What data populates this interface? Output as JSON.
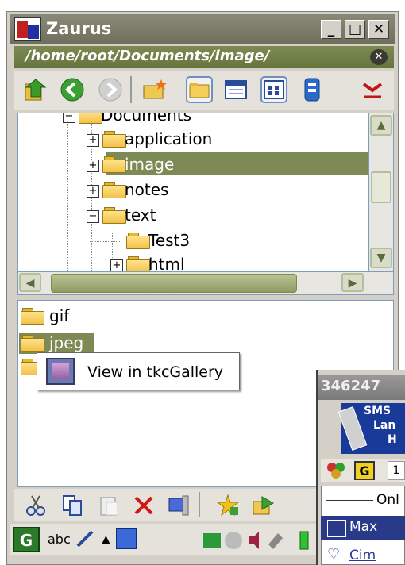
{
  "window": {
    "title": "Zaurus"
  },
  "pathbar": {
    "path": "/home/root/Documents/image/",
    "close_icon": "close-icon"
  },
  "toolbar": {
    "icons": [
      "up-folder-icon",
      "back-icon",
      "forward-icon",
      "new-folder-icon",
      "folder-view-icon",
      "list-view-icon",
      "detail-view-icon",
      "device-icon",
      "close-view-icon"
    ]
  },
  "tree": {
    "items": [
      {
        "label": "Documents",
        "expander": "⊟"
      },
      {
        "label": "application",
        "expander": "⊞"
      },
      {
        "label": "image",
        "expander": "⊞",
        "selected": true
      },
      {
        "label": "notes",
        "expander": "⊞"
      },
      {
        "label": "text",
        "expander": "⊟"
      },
      {
        "label": "Test3",
        "expander": ""
      },
      {
        "label": "html",
        "expander": "⊞"
      }
    ]
  },
  "list": {
    "items": [
      {
        "label": "gif"
      },
      {
        "label": "jpeg",
        "selected": true
      }
    ]
  },
  "context_menu": {
    "item_label": "View in tkcGallery"
  },
  "bottom_toolbar": {
    "icons": [
      "cut-icon",
      "copy-icon",
      "paste-icon",
      "delete-icon",
      "properties-icon",
      "favorite-icon",
      "send-icon"
    ]
  },
  "taskbar": {
    "input_method": "abc",
    "icons": [
      "start-icon",
      "handwriting-icon",
      "up-arrow-icon",
      "applet-icon",
      "tray-icons"
    ]
  },
  "popup": {
    "title": "346247",
    "banner_lines": [
      "SMS",
      "Lan",
      "H"
    ],
    "tab_label": "G",
    "tab_extra": "1",
    "rows": [
      {
        "label": "Onl"
      },
      {
        "label": "Max",
        "selected": true
      },
      {
        "label": "Cim"
      }
    ]
  },
  "colors": {
    "title_bar": "#7a7a68",
    "path_bar": "#6f7d46",
    "selection": "#7e8a56",
    "popup_selection": "#2a3a8a"
  }
}
